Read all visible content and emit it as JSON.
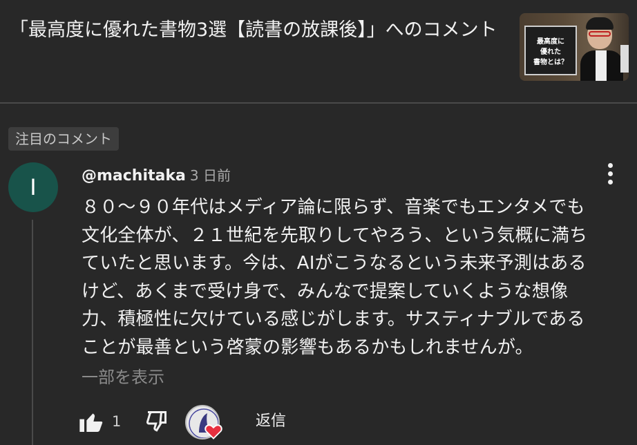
{
  "header": {
    "title": "「最高度に優れた書物3選【読書の放課後】」へのコメント",
    "thumbnail_text": [
      "最高度に",
      "優れた",
      "書物とは？"
    ]
  },
  "pinned_label": "注目のコメント",
  "comment": {
    "avatar_letter": "I",
    "avatar_color": "#18534a",
    "author": "@machitaka",
    "time": "3 日前",
    "body_lines": [
      "８０〜９０年代はメディア論に限らず、音楽でもエンタメでも",
      "文化全体が、２１世紀を先取りしてやろう、という気概に満ち",
      "ていたと思います。今は、AIがこうなるという未来予測はある",
      "けど、あくまで受け身で、みんなで提案していくような想像",
      "力、積極性に欠けている感じがします。サスティナブルである",
      "ことが最善という啓蒙の影響もあるかもしれませんが。"
    ],
    "show_more": "一部を表示",
    "likes": "1",
    "reply": "返信",
    "heart_color": "#e8303f"
  }
}
